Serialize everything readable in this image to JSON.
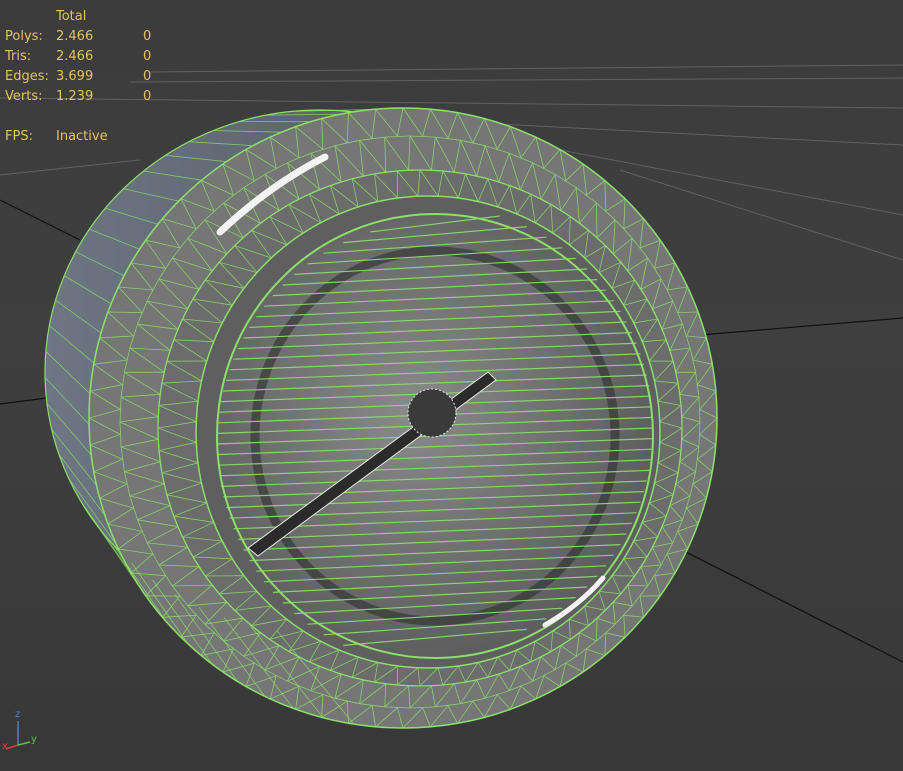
{
  "stats": {
    "header": "Total",
    "rows": [
      {
        "label": "Polys:",
        "total": "2.466",
        "selected": "0"
      },
      {
        "label": "Tris:",
        "total": "2.466",
        "selected": "0"
      },
      {
        "label": "Edges:",
        "total": "3.699",
        "selected": "0"
      },
      {
        "label": "Verts:",
        "total": "1.239",
        "selected": "0"
      }
    ],
    "fps_label": "FPS:",
    "fps_value": "Inactive"
  },
  "gizmo": {
    "x": "x",
    "y": "y",
    "z": "z"
  },
  "colors": {
    "viewport_bg": "#3c3c3c",
    "wireframe": "#8be06a",
    "stats_text": "#e6c25a",
    "grid": "#6a6a6a",
    "axis_x": "#d24141",
    "axis_y": "#5bc44a",
    "axis_z": "#4a7fd6"
  }
}
